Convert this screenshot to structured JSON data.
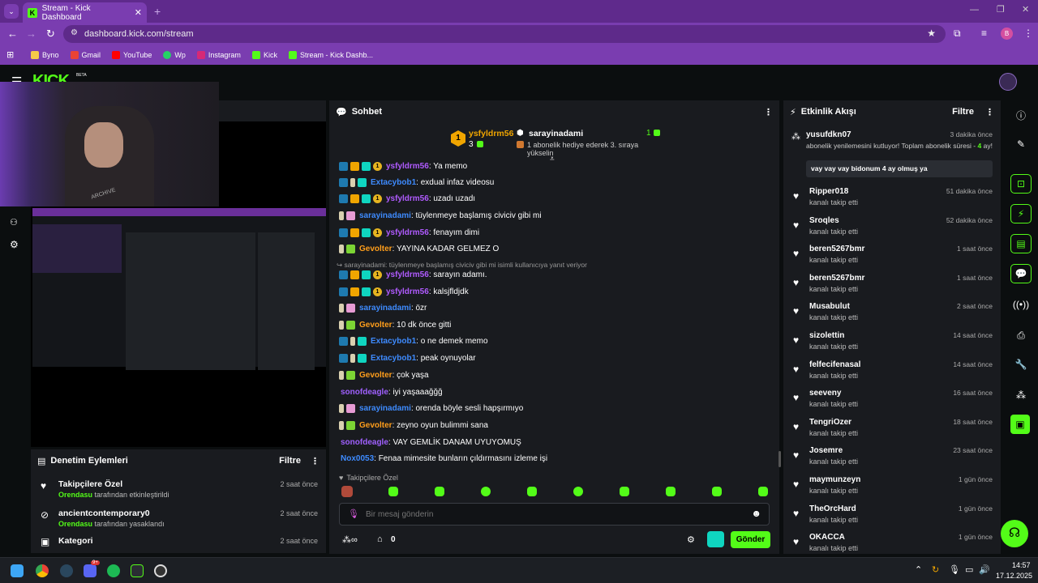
{
  "browser": {
    "tab_title": "Stream - Kick Dashboard",
    "url": "dashboard.kick.com/stream",
    "profile_letter": "B",
    "bookmarks": [
      "Byno",
      "Gmail",
      "YouTube",
      "Wp",
      "Instagram",
      "Kick",
      "Stream - Kick Dashb..."
    ]
  },
  "kick": {
    "logo": "KICK",
    "beta": "BETA"
  },
  "chat": {
    "title": "Sohbet",
    "pinned": {
      "user1": "ysfyldrm56",
      "count1": "3",
      "user2": "sarayinadami",
      "count2": "1",
      "sub_text": "1 abonelik hediye ederek 3. sıraya yükselin"
    },
    "lines": [
      {
        "user": "ysfyldrm56",
        "msg": ": Ya memo",
        "cls": "u-purple",
        "badges": [
          "b-blue",
          "b-gold",
          "b-teal",
          "b-coin"
        ]
      },
      {
        "user": "Extacybob1",
        "msg": ": exdual infaz videosu",
        "cls": "u-blue",
        "badges": [
          "b-blue",
          "b-bottle",
          "b-teal"
        ]
      },
      {
        "user": "ysfyldrm56",
        "msg": ": uzadı uzadı",
        "cls": "u-purple",
        "badges": [
          "b-blue",
          "b-gold",
          "b-teal",
          "b-coin"
        ]
      },
      {
        "user": "sarayinadami",
        "msg": ": tüylenmeye başlamış civiciv gibi mi",
        "cls": "u-blue",
        "badges": [
          "b-bottle",
          "b-pink"
        ]
      },
      {
        "user": "ysfyldrm56",
        "msg": ": fenayım dimi",
        "cls": "u-purple",
        "badges": [
          "b-blue",
          "b-gold",
          "b-teal",
          "b-coin"
        ]
      },
      {
        "user": "Gevolter",
        "msg": ": YAYINA KADAR GELMEZ O",
        "cls": "u-orange",
        "badges": [
          "b-bottle",
          "b-lime"
        ]
      },
      {
        "user": "",
        "msg": "↪ sarayinadami: tüylenmeye başlamış civiciv gibi mi isimli kullanıcıya yanıt veriyor",
        "cls": "",
        "badges": [],
        "reply": true
      },
      {
        "user": "ysfyldrm56",
        "msg": ": sarayın adamı.",
        "cls": "u-purple",
        "badges": [
          "b-blue",
          "b-gold",
          "b-teal",
          "b-coin"
        ]
      },
      {
        "user": "ysfyldrm56",
        "msg": ": kalsjfldjdk",
        "cls": "u-purple",
        "badges": [
          "b-blue",
          "b-gold",
          "b-teal",
          "b-coin"
        ]
      },
      {
        "user": "sarayinadami",
        "msg": ": özr",
        "cls": "u-blue",
        "badges": [
          "b-bottle",
          "b-pink"
        ]
      },
      {
        "user": "Gevolter",
        "msg": ": 10 dk önce gitti",
        "cls": "u-orange",
        "badges": [
          "b-bottle",
          "b-lime"
        ]
      },
      {
        "user": "Extacybob1",
        "msg": ": o ne demek memo",
        "cls": "u-blue",
        "badges": [
          "b-blue",
          "b-bottle",
          "b-teal"
        ]
      },
      {
        "user": "Extacybob1",
        "msg": ": peak oynuyolar",
        "cls": "u-blue",
        "badges": [
          "b-blue",
          "b-bottle",
          "b-teal"
        ]
      },
      {
        "user": "Gevolter",
        "msg": ": çok yaşa",
        "cls": "u-orange",
        "badges": [
          "b-bottle",
          "b-lime"
        ]
      },
      {
        "user": "sonofdeagle",
        "msg": ": iyi yaşaaağğğ",
        "cls": "u-violet",
        "badges": []
      },
      {
        "user": "sarayinadami",
        "msg": ": orenda böyle sesli hapşırmıyo",
        "cls": "u-blue",
        "badges": [
          "b-bottle",
          "b-pink"
        ]
      },
      {
        "user": "Gevolter",
        "msg": ": zeyno oyun bulimmi sana",
        "cls": "u-orange",
        "badges": [
          "b-bottle",
          "b-lime"
        ]
      },
      {
        "user": "sonofdeagle",
        "msg": ": VAY GEMLİK DANAM UYUYOMUŞ",
        "cls": "u-violet",
        "badges": []
      },
      {
        "user": "Nox0053",
        "msg": ": Fenaa mimesite bunların çıldırmasını izleme işi",
        "cls": "u-blue",
        "badges": []
      }
    ],
    "followers_only": "Takipçilere Özel",
    "input_placeholder": "Bir mesaj gönderin",
    "points": "0",
    "send_label": "Gönder"
  },
  "activity": {
    "title": "Etkinlik Akışı",
    "filter": "Filtre",
    "top": {
      "user": "yusufdkn07",
      "time": "3 dakika önce",
      "text_a": "abonelik yenilemesini kutluyor! Toplam abonelik süresi - ",
      "highlight": "4",
      "text_b": "ay!",
      "message": "vay vay vay bidonum 4 ay olmuş ya"
    },
    "items": [
      {
        "user": "Ripper018",
        "sub": "kanalı takip etti",
        "time": "51 dakika önce"
      },
      {
        "user": "Sroqles",
        "sub": "kanalı takip etti",
        "time": "52 dakika önce"
      },
      {
        "user": "beren5267bmr",
        "sub": "kanalı takip etti",
        "time": "1 saat önce"
      },
      {
        "user": "beren5267bmr",
        "sub": "kanalı takip etti",
        "time": "1 saat önce"
      },
      {
        "user": "Musabulut",
        "sub": "kanalı takip etti",
        "time": "2 saat önce"
      },
      {
        "user": "sizolettin",
        "sub": "kanalı takip etti",
        "time": "14 saat önce"
      },
      {
        "user": "felfecifenasal",
        "sub": "kanalı takip etti",
        "time": "14 saat önce"
      },
      {
        "user": "seeveny",
        "sub": "kanalı takip etti",
        "time": "16 saat önce"
      },
      {
        "user": "TengriOzer",
        "sub": "kanalı takip etti",
        "time": "18 saat önce"
      },
      {
        "user": "Josemre",
        "sub": "kanalı takip etti",
        "time": "23 saat önce"
      },
      {
        "user": "maymunzeyn",
        "sub": "kanalı takip etti",
        "time": "1 gün önce"
      },
      {
        "user": "TheOrcHard",
        "sub": "kanalı takip etti",
        "time": "1 gün önce"
      },
      {
        "user": "OKACCA",
        "sub": "kanalı takip etti",
        "time": "1 gün önce"
      }
    ]
  },
  "moderation": {
    "title": "Denetim Eylemleri",
    "filter": "Filtre",
    "items": [
      {
        "title": "Takipçilere Özel",
        "actor": "Orendasu",
        "rest": " tarafından etkinleştirildi",
        "time": "2 saat önce"
      },
      {
        "title": "ancientcontemporary0",
        "actor": "Orendasu",
        "rest": " tarafından yasaklandı",
        "time": "2 saat önce"
      },
      {
        "title": "Kategori",
        "actor": "",
        "rest": "",
        "time": "2 saat önce"
      }
    ]
  },
  "taskbar": {
    "time": "14:57",
    "date": "17.12.2025",
    "badge": "9+"
  },
  "webcam": {
    "shirt_text": "ARCHIVE"
  }
}
